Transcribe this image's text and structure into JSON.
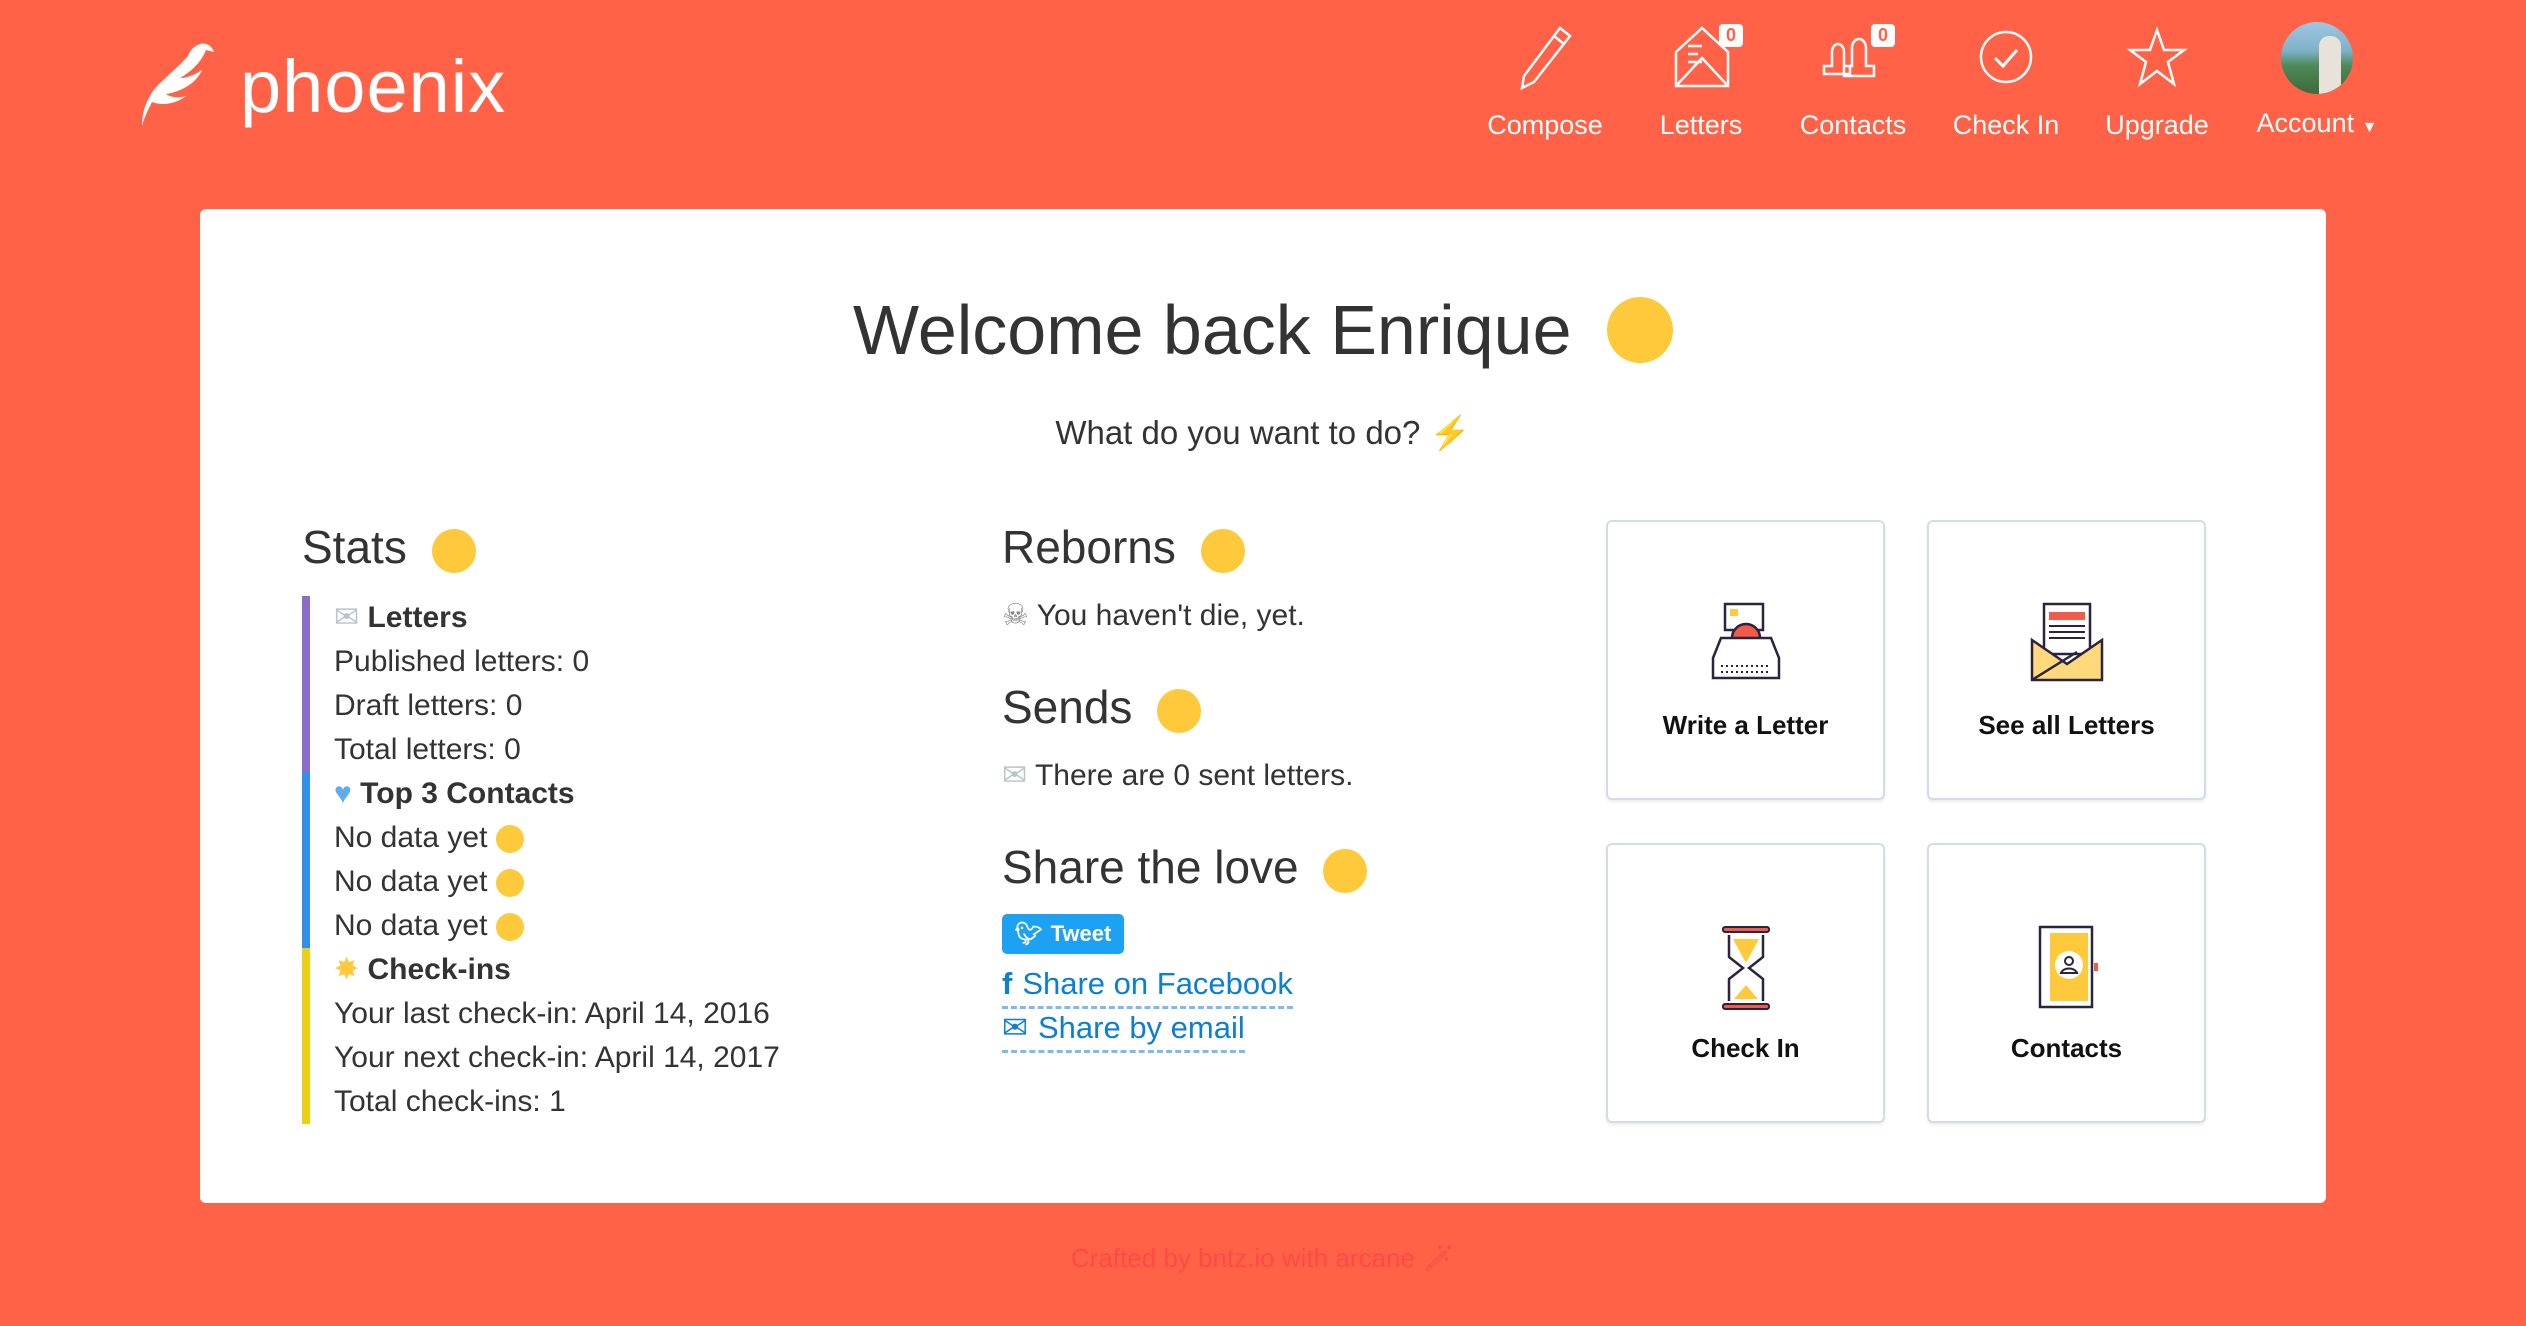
{
  "brand": {
    "name": "phoenix"
  },
  "nav": [
    {
      "label": "Compose",
      "icon": "pencil-icon"
    },
    {
      "label": "Letters",
      "icon": "envelope-letter-icon",
      "badge": "0"
    },
    {
      "label": "Contacts",
      "icon": "users-icon",
      "badge": "0"
    },
    {
      "label": "Check In",
      "icon": "check-circle-icon"
    },
    {
      "label": "Upgrade",
      "icon": "star-icon"
    },
    {
      "label": "Account",
      "icon": "avatar"
    }
  ],
  "welcome": {
    "title": "Welcome back Enrique",
    "subtitle": "What do you want to do?"
  },
  "stats": {
    "heading": "Stats",
    "letters": {
      "title": "Letters",
      "color": "#8A6CC9",
      "lines": [
        "Published letters: 0",
        "Draft letters: 0",
        "Total letters: 0"
      ]
    },
    "contacts": {
      "title": "Top 3 Contacts",
      "color": "#3291E6",
      "lines": [
        "No data yet",
        "No data yet",
        "No data yet"
      ]
    },
    "checkins": {
      "title": "Check-ins",
      "color": "#EDCF18",
      "lines": [
        "Your last check-in: April 14, 2016",
        "Your next check-in: April 14, 2017",
        "Total check-ins: 1"
      ]
    }
  },
  "reborns": {
    "heading": "Reborns",
    "text": "You haven't die, yet."
  },
  "sends": {
    "heading": "Sends",
    "text": "There are 0 sent letters."
  },
  "share": {
    "heading": "Share the love",
    "tweet": "Tweet",
    "facebook": "Share on Facebook",
    "email": "Share by email"
  },
  "cards": [
    {
      "label": "Write a Letter",
      "icon": "typewriter-icon"
    },
    {
      "label": "See all Letters",
      "icon": "open-envelope-icon"
    },
    {
      "label": "Check In",
      "icon": "hourglass-icon"
    },
    {
      "label": "Contacts",
      "icon": "address-book-icon"
    }
  ],
  "footer": {
    "text": "Crafted by bntz.io with arcane"
  },
  "colors": {
    "background": "#FF6247",
    "link": "#0C7FD0",
    "tweet": "#1DA1F2"
  }
}
